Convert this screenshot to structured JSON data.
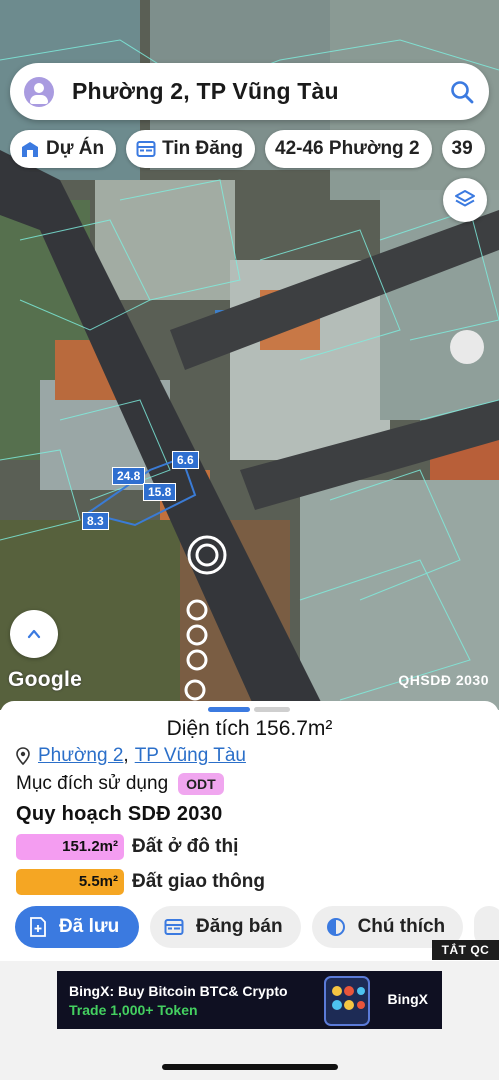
{
  "search": {
    "title": "Phường 2, TP Vũng Tàu"
  },
  "chips": [
    {
      "label": "Dự Án",
      "icon": "building-icon"
    },
    {
      "label": "Tin Đăng",
      "icon": "listing-icon"
    },
    {
      "label": "42-46 Phường 2",
      "icon": ""
    },
    {
      "label": "39",
      "icon": ""
    }
  ],
  "map": {
    "google_label": "Google",
    "layer_tag": "QHSDĐ 2030",
    "dimensions": [
      "6.6",
      "24.8",
      "15.8",
      "8.3"
    ]
  },
  "sheet": {
    "area_text": "Diện tích 156.7m²",
    "location": {
      "ward": "Phường 2",
      "separator": ",",
      "city": "TP Vũng Tàu"
    },
    "purpose_label": "Mục đích sử dụng",
    "purpose_code": "ODT",
    "plan_title": "Quy hoạch SDĐ 2030",
    "rows": [
      {
        "value": "151.2m²",
        "label": "Đất ở đô thị",
        "color": "#f49df1"
      },
      {
        "value": "5.5m²",
        "label": "Đất giao thông",
        "color": "#f5a623"
      }
    ],
    "actions": [
      {
        "label": "Đã lưu",
        "icon": "saved-doc-icon"
      },
      {
        "label": "Đăng bán",
        "icon": "listing-icon"
      },
      {
        "label": "Chú thích",
        "icon": "contrast-icon"
      }
    ]
  },
  "ad": {
    "tag": "TẮT QC",
    "headline": "BingX: Buy Bitcoin BTC& Crypto",
    "subline": "Trade 1,000+ Token",
    "brand": "BingX"
  },
  "colors": {
    "accent": "#3b7ae0",
    "link": "#2b6fc9"
  }
}
